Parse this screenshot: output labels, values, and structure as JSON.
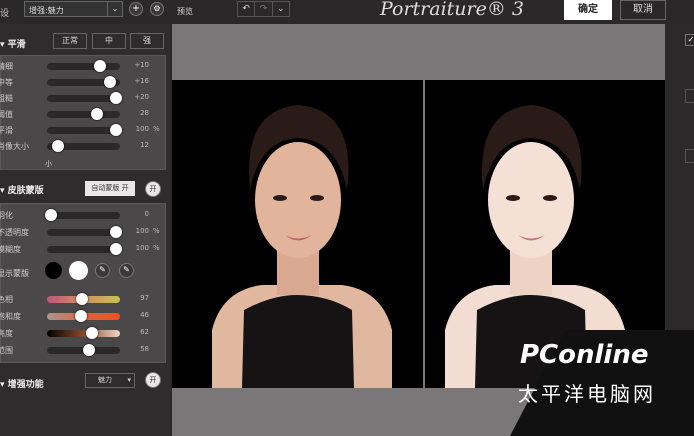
{
  "toolbar": {
    "preset_label": "设",
    "preset_value": "增强:魅力",
    "add_icon": "+",
    "gear_icon": "⚙",
    "preview_label": "预览",
    "undo": "↶",
    "redo": "↷",
    "more": "⌄",
    "app_title": "Portraiture® 3",
    "ok": "确定",
    "cancel": "取消"
  },
  "smoothing": {
    "title": "平滑",
    "modes": [
      "正常",
      "中",
      "强"
    ],
    "sliders": [
      {
        "label": "精细",
        "value": "+10",
        "pos": 0.72,
        "unit": ""
      },
      {
        "label": "中等",
        "value": "+16",
        "pos": 0.86,
        "unit": ""
      },
      {
        "label": "粗糙",
        "value": "+20",
        "pos": 0.95,
        "unit": ""
      },
      {
        "label": "阈值",
        "value": "28",
        "pos": 0.68,
        "unit": ""
      },
      {
        "label": "平滑",
        "value": "100",
        "pos": 0.95,
        "unit": "%"
      },
      {
        "label": "肖像大小",
        "value": "12",
        "pos": 0.15,
        "unit": ""
      }
    ],
    "size_hint": "小"
  },
  "skin_mask": {
    "title": "皮肤蒙版",
    "auto_button": "自动蒙版 开",
    "toggle": "开",
    "sliders": [
      {
        "label": "羽化",
        "value": "0",
        "pos": 0.05,
        "unit": ""
      },
      {
        "label": "不透明度",
        "value": "100",
        "pos": 0.95,
        "unit": "%"
      },
      {
        "label": "模糊度",
        "value": "100",
        "pos": 0.95,
        "unit": "%"
      }
    ],
    "show_mask_label": "显示蒙版",
    "color_sliders": [
      {
        "label": "色相",
        "value": "97",
        "pos": 0.48,
        "gradient": "linear-gradient(90deg,#c0567a,#d49060,#c8c050)"
      },
      {
        "label": "饱和度",
        "value": "46",
        "pos": 0.47,
        "gradient": "linear-gradient(90deg,#a89890,#e06040,#f05020)"
      },
      {
        "label": "亮度",
        "value": "62",
        "pos": 0.62,
        "gradient": "linear-gradient(90deg,#000,#8a4a28,#f0d8c8)"
      },
      {
        "label": "范围",
        "value": "58",
        "pos": 0.57,
        "gradient": "#2a2828"
      }
    ]
  },
  "enhance": {
    "title": "增强功能",
    "select": "魅力",
    "toggle": "开"
  },
  "watermark": {
    "brand": "PConline",
    "sub": "太平洋电脑网"
  }
}
